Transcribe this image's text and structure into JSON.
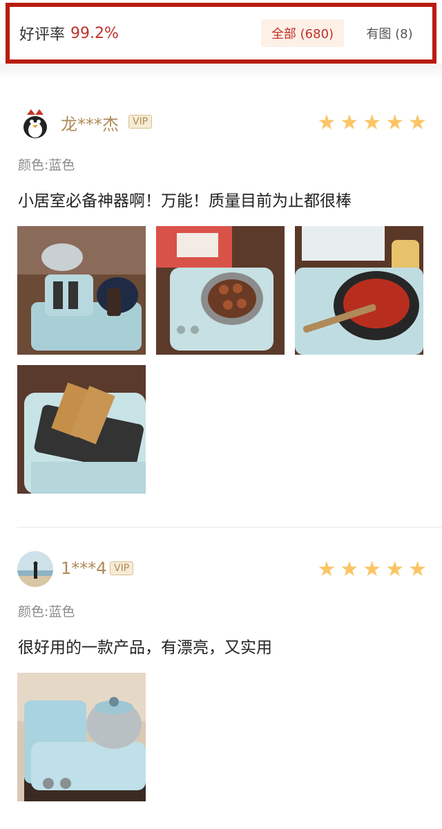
{
  "header": {
    "rate_label": "好评率",
    "rate_value": "99.2%",
    "filter_all": "全部 (680)",
    "filter_pic": "有图 (8)"
  },
  "colors": {
    "accent": "#c2302a",
    "border": "#b81c0e",
    "star": "#fbc465",
    "username": "#b08a58"
  },
  "reviews": [
    {
      "username": "龙***杰",
      "vip": "VIP",
      "rating": 5,
      "attr": "颜色:蓝色",
      "content": "小居室必备神器啊！万能！质量目前为止都很棒",
      "photos": [
        "breakfast-machine-overview",
        "steamer-eggs",
        "frying-sausages",
        "toast-slots"
      ]
    },
    {
      "username": "1***4",
      "vip": "VIP",
      "rating": 5,
      "attr": "颜色:蓝色",
      "content": "很好用的一款产品，有漂亮，又实用",
      "photos": [
        "machine-with-steamer"
      ]
    }
  ]
}
